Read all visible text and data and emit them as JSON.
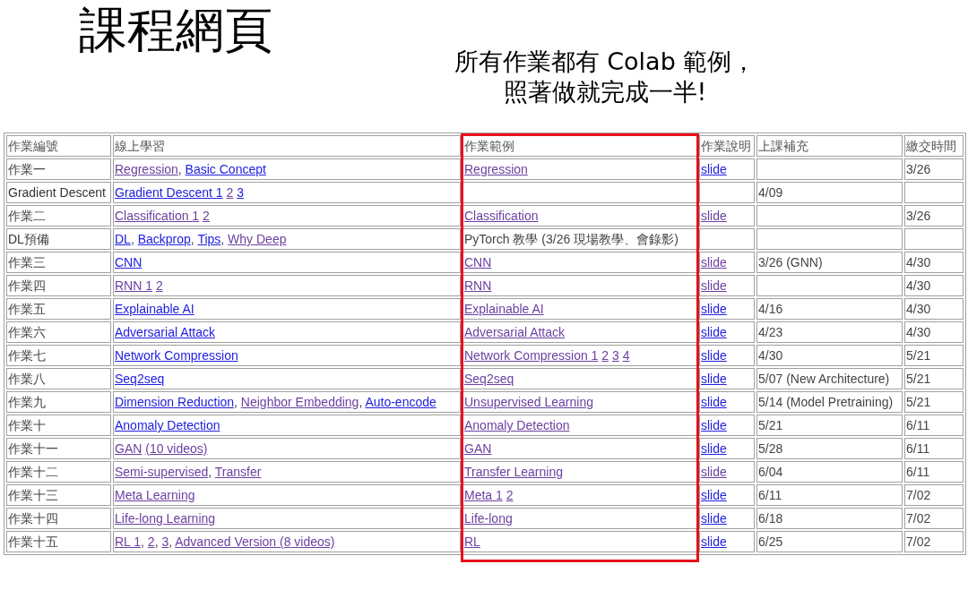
{
  "slide": {
    "title": "課程網頁",
    "subtitle_lines": [
      "所有作業都有 Colab 範例，",
      "照著做就完成一半!"
    ]
  },
  "table": {
    "columns": [
      {
        "label": "作業編號",
        "highlighted": false
      },
      {
        "label": "線上學習",
        "highlighted": false
      },
      {
        "label": "作業範例",
        "highlighted": true
      },
      {
        "label": "作業說明",
        "highlighted": false
      },
      {
        "label": "上課補充",
        "highlighted": false
      },
      {
        "label": "繳交時間",
        "highlighted": false
      }
    ],
    "rows": [
      [
        [
          {
            "kind": "text",
            "text": "作業一"
          }
        ],
        [
          {
            "kind": "link",
            "text": "Regression",
            "visited": true
          },
          {
            "kind": "text",
            "text": ", "
          },
          {
            "kind": "link",
            "text": "Basic Concept",
            "visited": false
          }
        ],
        [
          {
            "kind": "link",
            "text": "Regression",
            "visited": true
          }
        ],
        [
          {
            "kind": "link",
            "text": "slide",
            "visited": false
          }
        ],
        [],
        [
          {
            "kind": "text",
            "text": "3/26"
          }
        ]
      ],
      [
        [
          {
            "kind": "text",
            "text": "Gradient Descent"
          }
        ],
        [
          {
            "kind": "link",
            "text": "Gradient Descent 1",
            "visited": false
          },
          {
            "kind": "text",
            "text": " "
          },
          {
            "kind": "link",
            "text": "2",
            "visited": true
          },
          {
            "kind": "text",
            "text": " "
          },
          {
            "kind": "link",
            "text": "3",
            "visited": false
          }
        ],
        [],
        [],
        [
          {
            "kind": "text",
            "text": "4/09"
          }
        ],
        []
      ],
      [
        [
          {
            "kind": "text",
            "text": "作業二"
          }
        ],
        [
          {
            "kind": "link",
            "text": "Classification 1",
            "visited": true
          },
          {
            "kind": "text",
            "text": " "
          },
          {
            "kind": "link",
            "text": "2",
            "visited": true
          }
        ],
        [
          {
            "kind": "link",
            "text": "Classification",
            "visited": true
          }
        ],
        [
          {
            "kind": "link",
            "text": "slide",
            "visited": true
          }
        ],
        [],
        [
          {
            "kind": "text",
            "text": "3/26"
          }
        ]
      ],
      [
        [
          {
            "kind": "text",
            "text": "DL預備"
          }
        ],
        [
          {
            "kind": "link",
            "text": "DL",
            "visited": false
          },
          {
            "kind": "text",
            "text": ", "
          },
          {
            "kind": "link",
            "text": "Backprop",
            "visited": false
          },
          {
            "kind": "text",
            "text": ", "
          },
          {
            "kind": "link",
            "text": "Tips",
            "visited": false
          },
          {
            "kind": "text",
            "text": ", "
          },
          {
            "kind": "link",
            "text": "Why Deep",
            "visited": true
          }
        ],
        [
          {
            "kind": "text",
            "text": "PyTorch 教學 (3/26 現場教學、會錄影)"
          }
        ],
        [],
        [],
        []
      ],
      [
        [
          {
            "kind": "text",
            "text": "作業三"
          }
        ],
        [
          {
            "kind": "link",
            "text": "CNN",
            "visited": false
          }
        ],
        [
          {
            "kind": "link",
            "text": "CNN",
            "visited": true
          }
        ],
        [
          {
            "kind": "link",
            "text": "slide",
            "visited": true
          }
        ],
        [
          {
            "kind": "text",
            "text": "3/26 (GNN)"
          }
        ],
        [
          {
            "kind": "text",
            "text": "4/30"
          }
        ]
      ],
      [
        [
          {
            "kind": "text",
            "text": "作業四"
          }
        ],
        [
          {
            "kind": "link",
            "text": "RNN 1",
            "visited": true
          },
          {
            "kind": "text",
            "text": " "
          },
          {
            "kind": "link",
            "text": "2",
            "visited": true
          }
        ],
        [
          {
            "kind": "link",
            "text": "RNN",
            "visited": true
          }
        ],
        [
          {
            "kind": "link",
            "text": "slide",
            "visited": true
          }
        ],
        [],
        [
          {
            "kind": "text",
            "text": "4/30"
          }
        ]
      ],
      [
        [
          {
            "kind": "text",
            "text": "作業五"
          }
        ],
        [
          {
            "kind": "link",
            "text": "Explainable AI",
            "visited": false
          }
        ],
        [
          {
            "kind": "link",
            "text": "Explainable AI",
            "visited": true
          }
        ],
        [
          {
            "kind": "link",
            "text": "slide",
            "visited": false
          }
        ],
        [
          {
            "kind": "text",
            "text": "4/16"
          }
        ],
        [
          {
            "kind": "text",
            "text": "4/30"
          }
        ]
      ],
      [
        [
          {
            "kind": "text",
            "text": "作業六"
          }
        ],
        [
          {
            "kind": "link",
            "text": "Adversarial Attack",
            "visited": false
          }
        ],
        [
          {
            "kind": "link",
            "text": "Adversarial Attack",
            "visited": true
          }
        ],
        [
          {
            "kind": "link",
            "text": "slide",
            "visited": false
          }
        ],
        [
          {
            "kind": "text",
            "text": "4/23"
          }
        ],
        [
          {
            "kind": "text",
            "text": "4/30"
          }
        ]
      ],
      [
        [
          {
            "kind": "text",
            "text": "作業七"
          }
        ],
        [
          {
            "kind": "link",
            "text": "Network Compression",
            "visited": false
          }
        ],
        [
          {
            "kind": "link",
            "text": "Network Compression 1",
            "visited": true
          },
          {
            "kind": "text",
            "text": " "
          },
          {
            "kind": "link",
            "text": "2",
            "visited": true
          },
          {
            "kind": "text",
            "text": " "
          },
          {
            "kind": "link",
            "text": "3",
            "visited": true
          },
          {
            "kind": "text",
            "text": " "
          },
          {
            "kind": "link",
            "text": "4",
            "visited": true
          }
        ],
        [
          {
            "kind": "link",
            "text": "slide",
            "visited": false
          }
        ],
        [
          {
            "kind": "text",
            "text": "4/30"
          }
        ],
        [
          {
            "kind": "text",
            "text": "5/21"
          }
        ]
      ],
      [
        [
          {
            "kind": "text",
            "text": "作業八"
          }
        ],
        [
          {
            "kind": "link",
            "text": "Seq2seq",
            "visited": false
          }
        ],
        [
          {
            "kind": "link",
            "text": "Seq2seq",
            "visited": true
          }
        ],
        [
          {
            "kind": "link",
            "text": "slide",
            "visited": false
          }
        ],
        [
          {
            "kind": "text",
            "text": "5/07 (New Architecture)"
          }
        ],
        [
          {
            "kind": "text",
            "text": "5/21"
          }
        ]
      ],
      [
        [
          {
            "kind": "text",
            "text": "作業九"
          }
        ],
        [
          {
            "kind": "link",
            "text": "Dimension Reduction",
            "visited": false
          },
          {
            "kind": "text",
            "text": ", "
          },
          {
            "kind": "link",
            "text": "Neighbor Embedding",
            "visited": true
          },
          {
            "kind": "text",
            "text": ", "
          },
          {
            "kind": "link",
            "text": "Auto-encode",
            "visited": false
          }
        ],
        [
          {
            "kind": "link",
            "text": "Unsupervised Learning",
            "visited": true
          }
        ],
        [
          {
            "kind": "link",
            "text": "slide",
            "visited": false
          }
        ],
        [
          {
            "kind": "text",
            "text": "5/14 (Model Pretraining)"
          }
        ],
        [
          {
            "kind": "text",
            "text": "5/21"
          }
        ]
      ],
      [
        [
          {
            "kind": "text",
            "text": "作業十"
          }
        ],
        [
          {
            "kind": "link",
            "text": "Anomaly Detection",
            "visited": false
          }
        ],
        [
          {
            "kind": "link",
            "text": "Anomaly Detection",
            "visited": true
          }
        ],
        [
          {
            "kind": "link",
            "text": "slide",
            "visited": false
          }
        ],
        [
          {
            "kind": "text",
            "text": "5/21"
          }
        ],
        [
          {
            "kind": "text",
            "text": "6/11"
          }
        ]
      ],
      [
        [
          {
            "kind": "text",
            "text": "作業十一"
          }
        ],
        [
          {
            "kind": "link",
            "text": "GAN",
            "visited": true
          },
          {
            "kind": "text",
            "text": " "
          },
          {
            "kind": "link",
            "text": "(10 videos)",
            "visited": true
          }
        ],
        [
          {
            "kind": "link",
            "text": "GAN",
            "visited": true
          }
        ],
        [
          {
            "kind": "link",
            "text": "slide",
            "visited": false
          }
        ],
        [
          {
            "kind": "text",
            "text": "5/28"
          }
        ],
        [
          {
            "kind": "text",
            "text": "6/11"
          }
        ]
      ],
      [
        [
          {
            "kind": "text",
            "text": "作業十二"
          }
        ],
        [
          {
            "kind": "link",
            "text": "Semi-supervised",
            "visited": true
          },
          {
            "kind": "text",
            "text": ", "
          },
          {
            "kind": "link",
            "text": "Transfer",
            "visited": true
          }
        ],
        [
          {
            "kind": "link",
            "text": "Transfer Learning",
            "visited": true
          }
        ],
        [
          {
            "kind": "link",
            "text": "slide",
            "visited": true
          }
        ],
        [
          {
            "kind": "text",
            "text": "6/04"
          }
        ],
        [
          {
            "kind": "text",
            "text": "6/11"
          }
        ]
      ],
      [
        [
          {
            "kind": "text",
            "text": "作業十三"
          }
        ],
        [
          {
            "kind": "link",
            "text": "Meta Learning",
            "visited": true
          }
        ],
        [
          {
            "kind": "link",
            "text": "Meta 1",
            "visited": true
          },
          {
            "kind": "text",
            "text": " "
          },
          {
            "kind": "link",
            "text": "2",
            "visited": true
          }
        ],
        [
          {
            "kind": "link",
            "text": "slide",
            "visited": false
          }
        ],
        [
          {
            "kind": "text",
            "text": "6/11"
          }
        ],
        [
          {
            "kind": "text",
            "text": "7/02"
          }
        ]
      ],
      [
        [
          {
            "kind": "text",
            "text": "作業十四"
          }
        ],
        [
          {
            "kind": "link",
            "text": "Life-long Learning",
            "visited": true
          }
        ],
        [
          {
            "kind": "link",
            "text": "Life-long",
            "visited": true
          }
        ],
        [
          {
            "kind": "link",
            "text": "slide",
            "visited": false
          }
        ],
        [
          {
            "kind": "text",
            "text": "6/18"
          }
        ],
        [
          {
            "kind": "text",
            "text": "7/02"
          }
        ]
      ],
      [
        [
          {
            "kind": "text",
            "text": "作業十五"
          }
        ],
        [
          {
            "kind": "link",
            "text": "RL 1",
            "visited": true
          },
          {
            "kind": "text",
            "text": ", "
          },
          {
            "kind": "link",
            "text": "2",
            "visited": true
          },
          {
            "kind": "text",
            "text": ", "
          },
          {
            "kind": "link",
            "text": "3",
            "visited": true
          },
          {
            "kind": "text",
            "text": ", "
          },
          {
            "kind": "link",
            "text": "Advanced Version (8 videos)",
            "visited": true
          }
        ],
        [
          {
            "kind": "link",
            "text": "RL",
            "visited": true
          }
        ],
        [
          {
            "kind": "link",
            "text": "slide",
            "visited": false
          }
        ],
        [
          {
            "kind": "text",
            "text": "6/25"
          }
        ],
        [
          {
            "kind": "text",
            "text": "7/02"
          }
        ]
      ]
    ]
  }
}
